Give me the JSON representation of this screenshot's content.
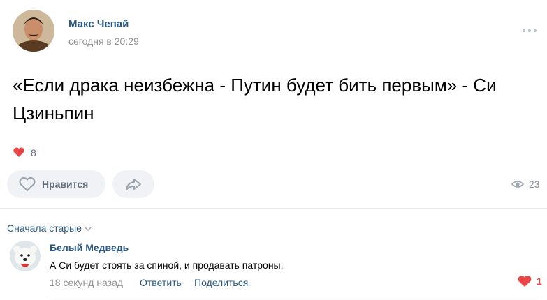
{
  "post": {
    "author": "Макс Чепай",
    "time": "сегодня в 20:29",
    "text": "«Если драка неизбежна - Путин будет бить первым» - Си Цзиньпин",
    "reactions_count": "8",
    "like_label": "Нравится",
    "views": "23"
  },
  "comments": {
    "sort_label": "Сначала старые",
    "items": [
      {
        "author": "Белый Медведь",
        "text": "А Си будет стоять за спиной, и продавать патроны.",
        "time": "18 секунд назад",
        "reply_label": "Ответить",
        "share_label": "Поделиться",
        "likes": "1"
      }
    ]
  },
  "colors": {
    "link": "#2a5885",
    "secondary": "#939393",
    "button_bg": "#f0f2f5",
    "heart": "#e64646"
  },
  "icons": [
    "more-icon",
    "heart-icon",
    "share-icon",
    "eye-icon",
    "chevron-down-icon"
  ]
}
